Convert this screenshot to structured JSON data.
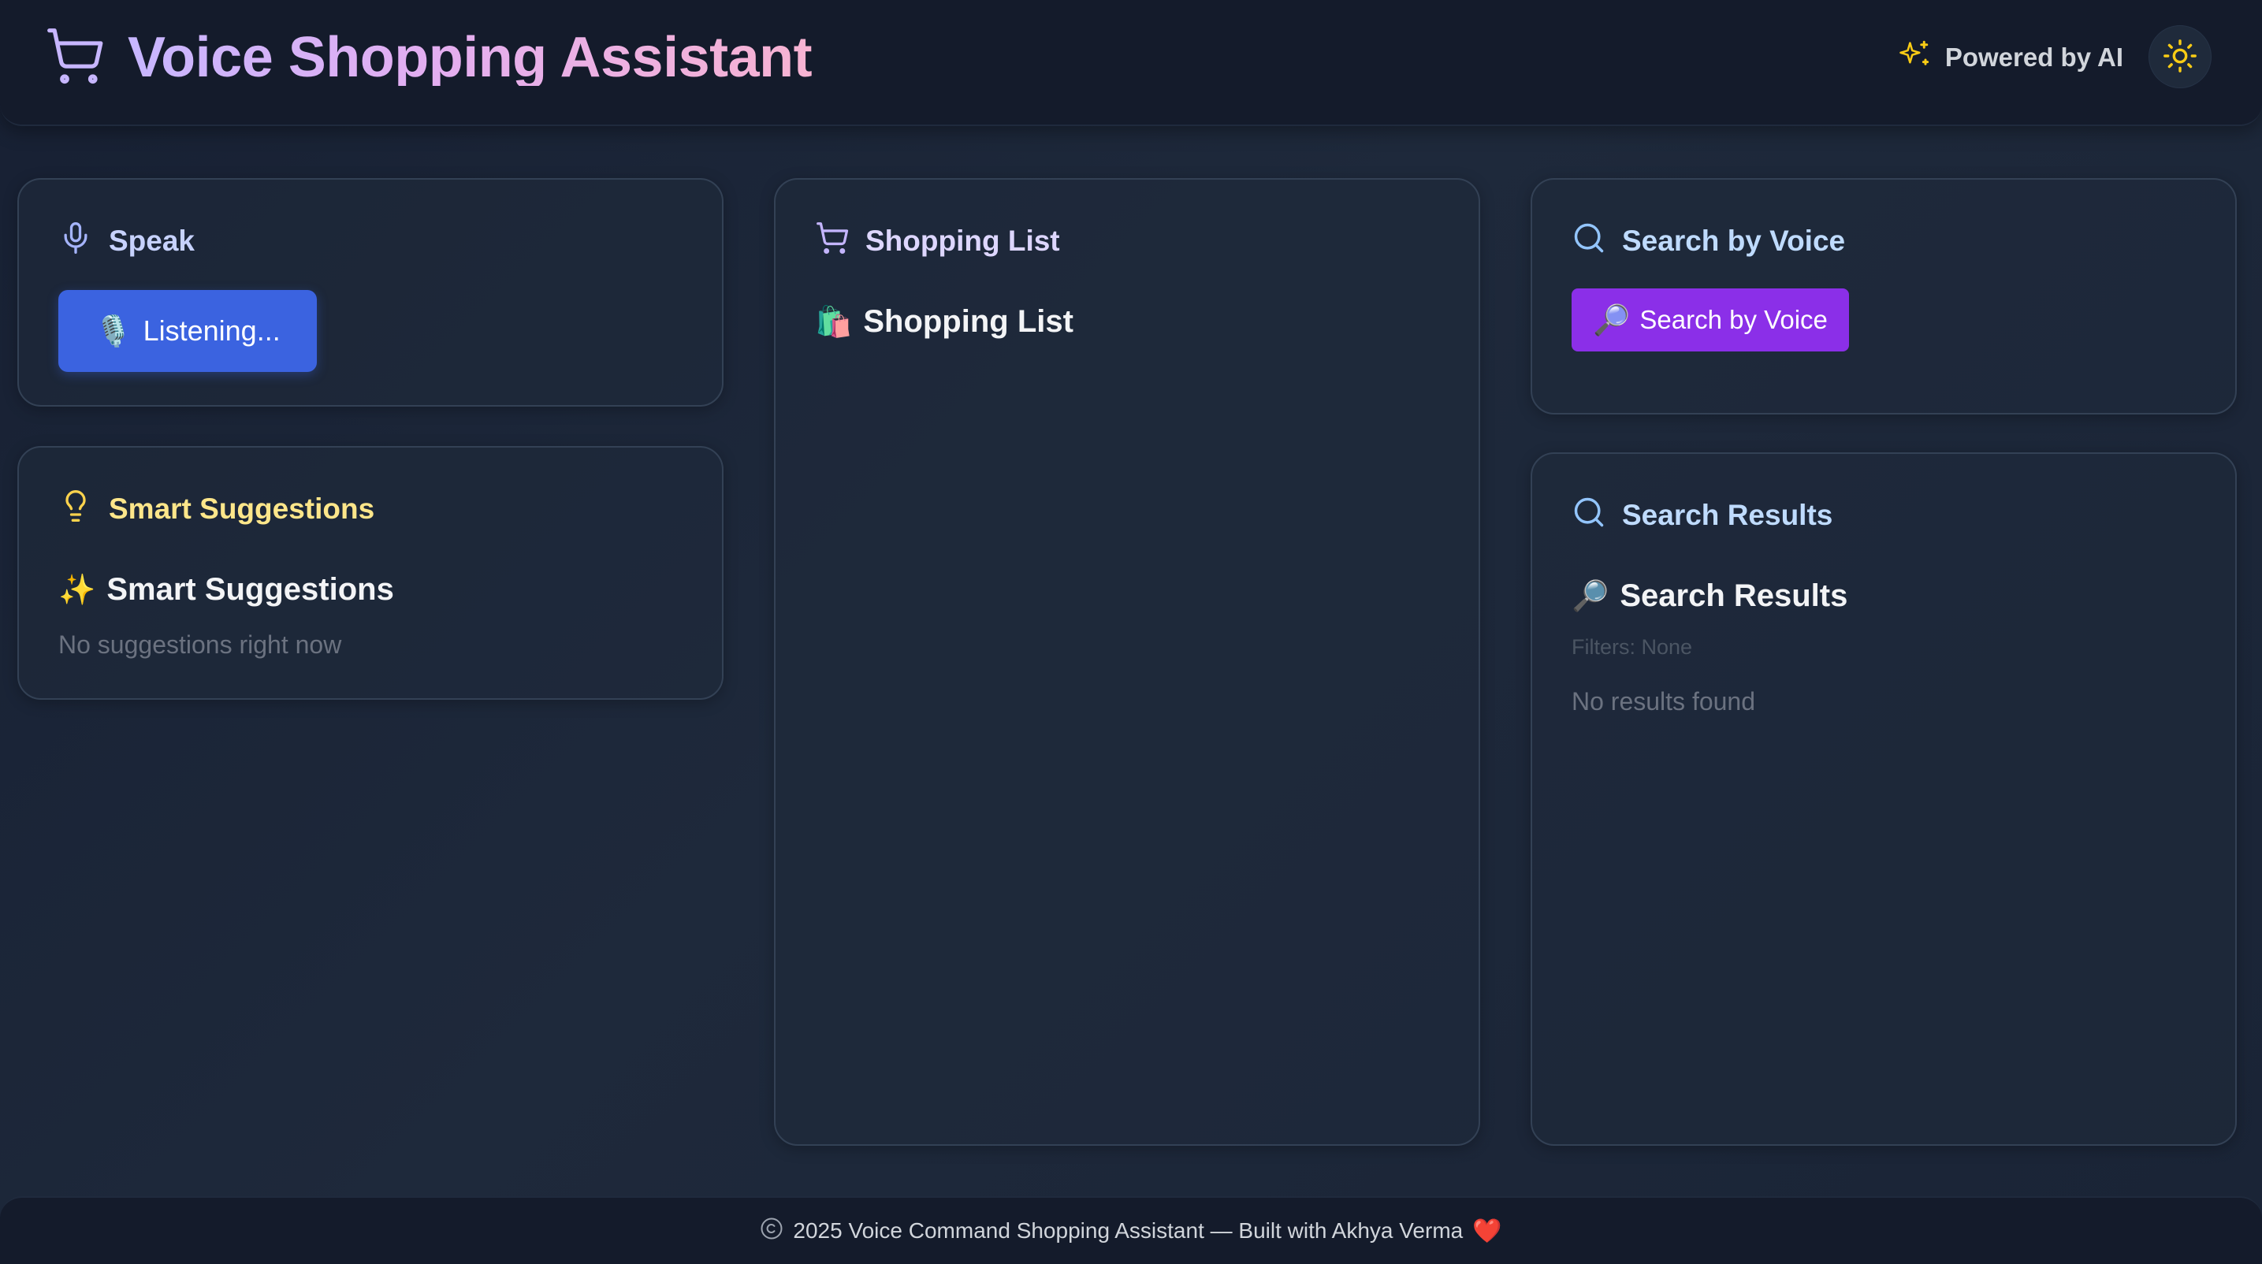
{
  "header": {
    "title": "Voice Shopping Assistant",
    "powered_label": "Powered by AI"
  },
  "speak_card": {
    "title": "Speak",
    "button_emoji": "🎙️",
    "button_label": "Listening..."
  },
  "suggestions_card": {
    "title": "Smart Suggestions",
    "sub_emoji": "✨",
    "sub_title": "Smart Suggestions",
    "empty_text": "No suggestions right now"
  },
  "list_card": {
    "title": "Shopping List",
    "sub_emoji": "🛍️",
    "sub_title": "Shopping List"
  },
  "search_card": {
    "title": "Search by Voice",
    "button_emoji": "🔎",
    "button_label": "Search by Voice"
  },
  "results_card": {
    "title": "Search Results",
    "sub_emoji": "🔎",
    "sub_title": "Search Results",
    "filters_text": "Filters: None",
    "empty_text": "No results found"
  },
  "footer": {
    "text": "2025 Voice Command Shopping Assistant — Built with Akhya Verma",
    "heart": "❤️"
  },
  "colors": {
    "listen_button": "#3b63e0",
    "search_button": "#8b2fe8",
    "background": "#1e293b",
    "suggestion_accent": "#fde68a"
  }
}
